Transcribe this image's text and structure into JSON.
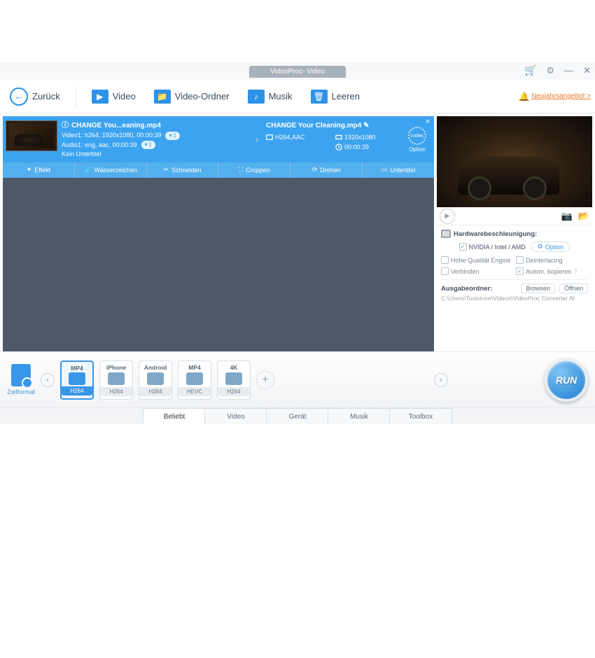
{
  "window": {
    "title": "VideoProc- Video"
  },
  "toolbar": {
    "back": "Zurück",
    "video": "Video",
    "folder": "Video-Ordner",
    "music": "Musik",
    "clear": "Leeren",
    "promo": "Neujahrsangebot >"
  },
  "file": {
    "input_name": "CHANGE You...eaning.mp4",
    "video_line": "Video1: h264, 1920x1080, 00:00:39",
    "audio_line": "Audio1: eng, aac, 00:00:39",
    "sub_line": "Kein Untertitel",
    "pill_v": "1",
    "pill_a": "1",
    "output_name": "CHANGE Your Cleaning.mp4",
    "codec": "H264,AAC",
    "res": "1920x1080",
    "dur": "00:00:39",
    "codec_label": "codec",
    "option_label": "Option"
  },
  "edit_tabs": {
    "effect": "Effekt",
    "watermark": "Wasserzeichen",
    "cut": "Schneiden",
    "crop": "Croppen",
    "rotate": "Drehen",
    "subtitle": "Untertitel"
  },
  "hw": {
    "title": "Hardwarebeschleunigung:",
    "vendor": "NVIDIA / Intel / AMD",
    "option": "Option",
    "hq": "Hohe Qualität Engine",
    "deint": "Deinterlacing",
    "merge": "Verbinden",
    "autocopy": "Autom. kopieren",
    "help": "?"
  },
  "output": {
    "label": "Ausgabeordner:",
    "browse": "Browsen",
    "open": "Öffnen",
    "path": "C:\\Users\\Toolstone\\Videos\\VideoProc Converter AI"
  },
  "formats": {
    "target_label": "Zielformat",
    "items": [
      {
        "top": "MP4",
        "bot": "H264",
        "sel": true
      },
      {
        "top": "iPhone",
        "bot": "H264",
        "sel": false
      },
      {
        "top": "Android",
        "bot": "H264",
        "sel": false
      },
      {
        "top": "MP4",
        "bot": "HEVC",
        "sel": false
      },
      {
        "top": "4K",
        "bot": "H264",
        "sel": false
      }
    ]
  },
  "bottom_tabs": {
    "popular": "Beliebt",
    "video": "Video",
    "device": "Gerät",
    "music": "Musik",
    "toolbox": "Toolbox"
  },
  "run": "RUN"
}
